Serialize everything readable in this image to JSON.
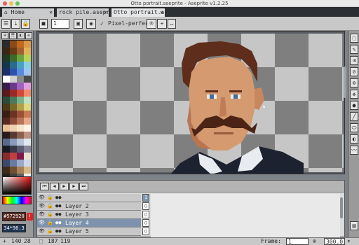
{
  "window": {
    "title": "Otto portrait.aseprite - Aseprite v1.2.25"
  },
  "tabs": [
    {
      "label": "Home",
      "active": false
    },
    {
      "label": "rock pile.asepr",
      "active": false
    },
    {
      "label": "Otto portrait.as",
      "active": true
    }
  ],
  "toolbar": {
    "brush_size": "1",
    "pixel_perfect_label": "Pixel-perfect",
    "pixel_perfect_checked": true
  },
  "palette": {
    "tabs": [
      "⊕",
      "☰",
      "◧",
      "≡"
    ],
    "colors": [
      "#2b2b2b",
      "#8a4a1c",
      "#c06a20",
      "#d89a4a",
      "#3a2614",
      "#6a3a18",
      "#a06030",
      "#e2b25a",
      "#1f3a20",
      "#3b6a2a",
      "#6aa43a",
      "#b8d45a",
      "#14354a",
      "#2a6a8a",
      "#4aa0c0",
      "#8ad0e0",
      "#1a2e6a",
      "#2a52a8",
      "#5a8ae0",
      "#a0c4f0",
      "#ffffff",
      "#d0d0d0",
      "#8a8a8a",
      "#4a4a4a",
      "#3a1a4a",
      "#6a3a8a",
      "#a060c0",
      "#e0a0e0",
      "#5a1a1a",
      "#9a2a2a",
      "#d04a3a",
      "#f08a6a",
      "#2a4a3a",
      "#4a7a5a",
      "#7ab08a",
      "#c0e0c0",
      "#4a3a1a",
      "#7a6a2a",
      "#b0a04a",
      "#e0d880",
      "#3a1e14",
      "#6a3422",
      "#9a5236",
      "#c87a52",
      "#572920",
      "#8a4a38",
      "#b87458",
      "#e8a888",
      "#e8c098",
      "#f0d0b0",
      "#f8e4cc",
      "#fff4e8",
      "#2a1a1a",
      "#5a3a30",
      "#8a6050",
      "#c09080",
      "#5a6a8a",
      "#8a9ab8",
      "#b8c4d8",
      "#e0e8f0",
      "#1a1a24",
      "#383848",
      "#5a5a70",
      "#84849a",
      "#8a2a2a",
      "#c04040",
      "#7a1a4a",
      "#e8e0d0",
      "#3a4a6a",
      "#6a7aa0",
      "#9aaac8",
      "#d0d8e8",
      "#402a18",
      "#705030",
      "#a88058",
      "#d8b888",
      "#202020",
      "#404040",
      "#606060",
      "#f0f0f0"
    ],
    "fg_hex": "#572920",
    "zoom_readout": "34*96.3"
  },
  "tools": [
    "marquee-icon",
    "pencil-icon",
    "eraser-icon",
    "eyedropper-icon",
    "zoom-icon",
    "move-icon",
    "fill-icon",
    "line-icon",
    "ellipse-icon",
    "contour-icon",
    "blur-icon"
  ],
  "timeline": {
    "buttons": [
      "⏮",
      "◀",
      "▶",
      "▶",
      "⏭"
    ],
    "frame_header": "1",
    "layers": [
      {
        "name": "",
        "selected": false
      },
      {
        "name": "Layer 2",
        "selected": false
      },
      {
        "name": "Layer 3",
        "selected": false
      },
      {
        "name": "Layer 4",
        "selected": true
      },
      {
        "name": "Layer 5",
        "selected": false
      }
    ]
  },
  "status": {
    "cursor_x": "140",
    "cursor_y": "28",
    "size_w": "187",
    "size_h": "119",
    "frame_label": "Frame:",
    "frame_value": "1",
    "zoom_value": "300.0"
  }
}
